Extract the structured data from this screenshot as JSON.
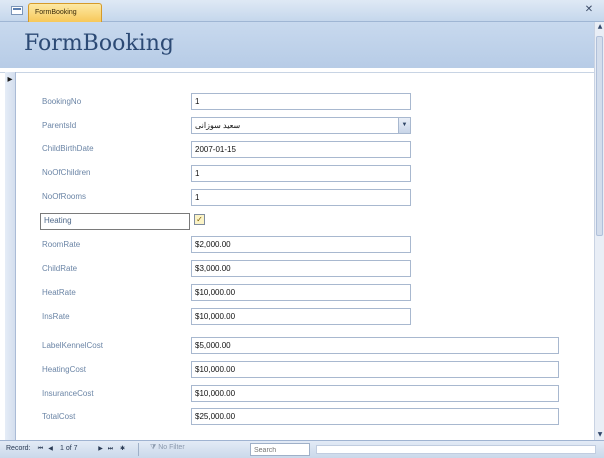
{
  "tab": {
    "label": "FormBooking"
  },
  "header": {
    "title": "FormBooking"
  },
  "fields": [
    {
      "id": "bookingno",
      "label": "BookingNo",
      "value": "1"
    },
    {
      "id": "parentsid",
      "label": "ParentsId",
      "value": "سعيد سوزانى"
    },
    {
      "id": "childbirthdate",
      "label": "ChildBirthDate",
      "value": "2007-01-15"
    },
    {
      "id": "noofchildren",
      "label": "NoOfChildren",
      "value": "1"
    },
    {
      "id": "noofrooms",
      "label": "NoOfRooms",
      "value": "1"
    },
    {
      "id": "heating",
      "label": "Heating",
      "value": "checked"
    },
    {
      "id": "roomrate",
      "label": "RoomRate",
      "value": "$2,000.00"
    },
    {
      "id": "childrate",
      "label": "ChildRate",
      "value": "$3,000.00"
    },
    {
      "id": "heatrate",
      "label": "HeatRate",
      "value": "$10,000.00"
    },
    {
      "id": "insrate",
      "label": "InsRate",
      "value": "$10,000.00"
    },
    {
      "id": "labelkennelcost",
      "label": "LabelKennelCost",
      "value": "$5,000.00"
    },
    {
      "id": "heatingcost",
      "label": "HeatingCost",
      "value": "$10,000.00"
    },
    {
      "id": "insurancecost",
      "label": "InsuranceCost",
      "value": "$10,000.00"
    },
    {
      "id": "totalcost",
      "label": "TotalCost",
      "value": "$25,000.00"
    }
  ],
  "navbar": {
    "record_label": "Record:",
    "record_position": "1 of 7",
    "filter_label": "No Filter",
    "search_placeholder": "Search"
  },
  "icons": {
    "form": "form-icon",
    "close": "close-icon",
    "dropdown": "chevron-down-icon",
    "first": "first-record-icon",
    "prev": "previous-record-icon",
    "next": "next-record-icon",
    "last": "last-record-icon",
    "new": "new-record-icon",
    "filter": "filter-icon"
  },
  "colors": {
    "header_bg": "#c8d9ee",
    "title_text": "#2c4a75",
    "label_text": "#6b85a6",
    "active_tab": "#f7c85a"
  }
}
